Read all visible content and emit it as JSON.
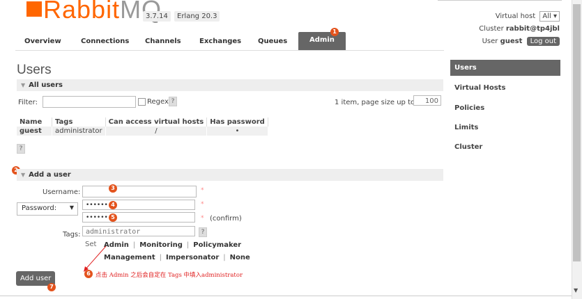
{
  "app": {
    "logo_rabbit": "Rabbit",
    "logo_mq": "MQ",
    "version": "3.7.14",
    "erlang": "Erlang 20.3"
  },
  "header": {
    "virtual_host_label": "Virtual host",
    "virtual_host_value": "All",
    "cluster_label": "Cluster",
    "cluster_value": "rabbit@tp4jbl",
    "user_label": "User",
    "user_value": "guest",
    "logout": "Log out"
  },
  "tabs": [
    "Overview",
    "Connections",
    "Channels",
    "Exchanges",
    "Queues",
    "Admin"
  ],
  "active_tab": "Admin",
  "page_title": "Users",
  "all_users": {
    "section_title": "All users",
    "filter_label": "Filter:",
    "regex_label": "Regex",
    "help": "?",
    "page_size_text": "1 item, page size up to",
    "page_size_value": "100",
    "columns": [
      "Name",
      "Tags",
      "Can access virtual hosts",
      "Has password"
    ],
    "rows": [
      {
        "name": "guest",
        "tags": "administrator",
        "vhosts": "/",
        "has_password": "•"
      }
    ]
  },
  "add_user": {
    "section_title": "Add a user",
    "username_label": "Username:",
    "username_value": "",
    "password_mode": "Password:",
    "password_dots": "••••••",
    "confirm_dots": "••••••",
    "required_mark": "*",
    "confirm_text": "(confirm)",
    "tags_label": "Tags:",
    "tags_value": "administrator",
    "set_label": "Set",
    "tag_options_row1": [
      "Admin",
      "Monitoring",
      "Policymaker"
    ],
    "tag_options_row2": [
      "Management",
      "Impersonator",
      "None"
    ],
    "separator": "|",
    "button_label": "Add user"
  },
  "sidebar": [
    "Users",
    "Virtual Hosts",
    "Policies",
    "Limits",
    "Cluster"
  ],
  "annotations": {
    "markers": [
      "1",
      "2",
      "3",
      "4",
      "5",
      "6",
      "7"
    ],
    "note": "点击 Admin 之后会自定在 Tags 中填入administrator",
    "color": "#e02020"
  },
  "colors": {
    "brand": "#ff6600",
    "active_tab": "#666666",
    "section_bg": "#eeeeee"
  }
}
